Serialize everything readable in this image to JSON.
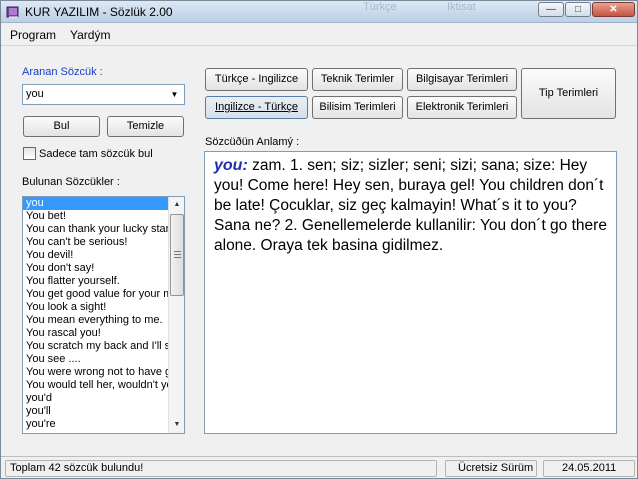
{
  "window": {
    "title": "KUR YAZILIM - Sözlük 2.00",
    "ghost_tabs": [
      "Türkçe",
      "Iktisat"
    ],
    "controls": {
      "minimize": "—",
      "maximize": "□",
      "close": "✕"
    }
  },
  "menu": {
    "items": [
      "Program",
      "Yardým"
    ]
  },
  "search": {
    "label": "Aranan Sözcük :",
    "value": "you",
    "find_button": "Bul",
    "clear_button": "Temizle",
    "exact_match_label": "Sadece tam sözcük bul",
    "exact_match_checked": false
  },
  "dictionaries": {
    "buttons": [
      "Türkçe - Ingilizce",
      "Teknik Terimler",
      "Bilgisayar Terimleri",
      "Ingilizce - Türkçe",
      "Bilisim Terimleri",
      "Elektronik Terimleri",
      "Tip Terimleri"
    ],
    "active": "Ingilizce - Türkçe"
  },
  "results": {
    "label": "Bulunan Sözcükler :",
    "items": [
      "you",
      "You bet!",
      "You can thank your lucky stars",
      "You can't be serious!",
      "You devil!",
      "You don't say!",
      "You flatter yourself.",
      "You get good value for your money",
      "You look a sight!",
      "You mean everything to me.",
      "You rascal you!",
      "You scratch my back and I'll scratch yours",
      "You see ....",
      "You were wrong not to have gone",
      "You would tell her, wouldn't you",
      "you'd",
      "you'll",
      "you're"
    ],
    "selected_index": 0
  },
  "meaning": {
    "label": "Sözcüðün Anlamý :",
    "headword": "you:",
    "text": " zam. 1. sen; siz; sizler; seni; sizi; sana; size: Hey you! Come here! Hey sen, buraya gel! You children don´t be late! Çocuklar, siz geç kalmayin! What´s it to you? Sana ne? 2. Genellemelerde kullanilir: You don´t go there alone. Oraya tek basina gidilmez."
  },
  "status": {
    "count_text": "Toplam 42 sözcük bulundu!",
    "license": "Ücretsiz Sürüm",
    "date": "24.05.2011"
  },
  "icons": {
    "app": "book-icon",
    "dropdown": "chevron-down-icon",
    "scroll_up": "arrow-up-icon",
    "scroll_down": "arrow-down-icon"
  },
  "colors": {
    "label_blue": "#1a3cc2",
    "headword_blue": "#1d2eb0",
    "selection": "#3399ff"
  }
}
